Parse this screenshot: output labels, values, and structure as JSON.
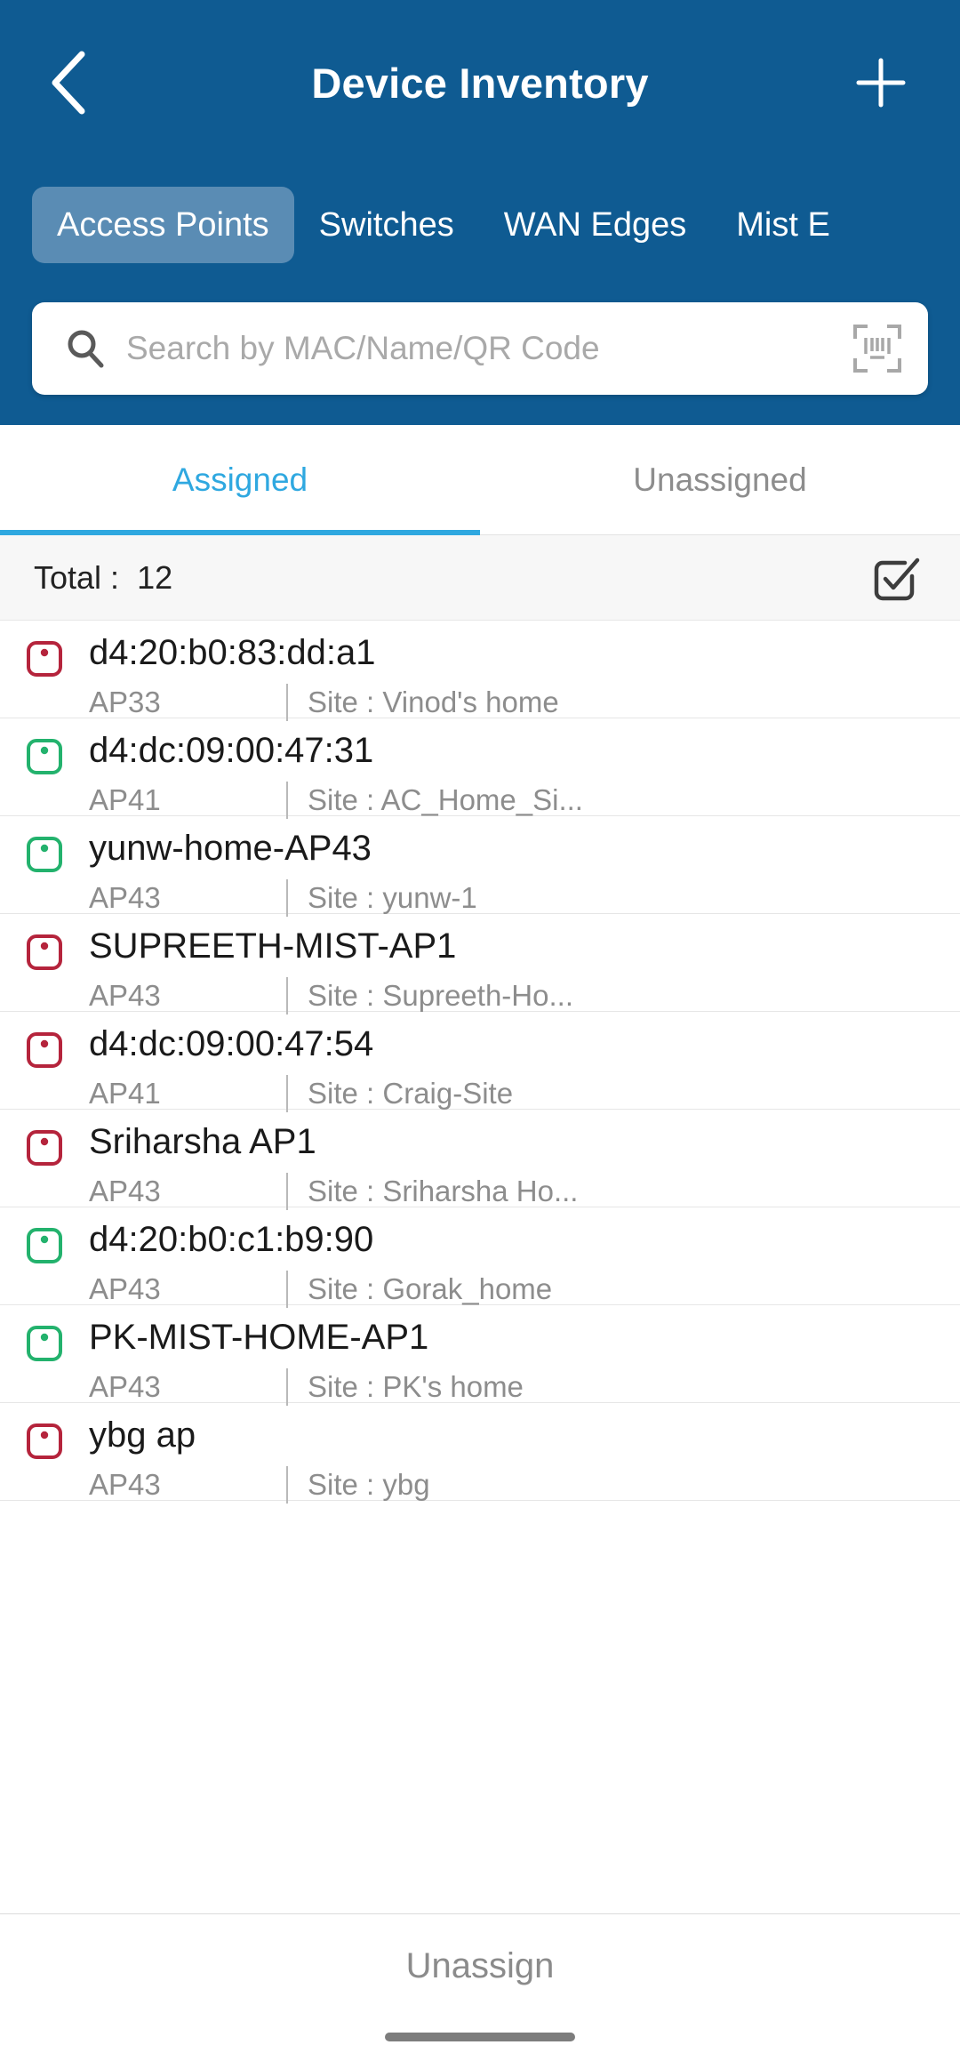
{
  "header": {
    "title": "Device Inventory",
    "back_icon": "chevron-left-icon",
    "add_icon": "plus-icon",
    "background_color": "#0f5b92",
    "category_tabs": [
      {
        "label": "Access Points",
        "active": true
      },
      {
        "label": "Switches",
        "active": false
      },
      {
        "label": "WAN Edges",
        "active": false
      },
      {
        "label": "Mist E",
        "active": false
      }
    ]
  },
  "search": {
    "placeholder": "Search by MAC/Name/QR Code",
    "value": "",
    "search_icon": "search-icon",
    "scan_icon": "barcode-scan-icon"
  },
  "sub_tabs": [
    {
      "label": "Assigned",
      "active": true
    },
    {
      "label": "Unassigned",
      "active": false
    }
  ],
  "summary": {
    "total_label": "Total :",
    "total_count": "12",
    "select_all_icon": "checkbox-checked-icon"
  },
  "accent_colors": {
    "active_tab": "#2fa8e0",
    "status_connected": "#23b26d",
    "status_disconnected": "#b5243c",
    "header_blue": "#0f5b92",
    "selected_pill": "#5a8cb4"
  },
  "devices": [
    {
      "status": "disconnected",
      "name": "d4:20:b0:83:dd:a1",
      "model": "AP33",
      "site": "Site : Vinod's home"
    },
    {
      "status": "connected",
      "name": "d4:dc:09:00:47:31",
      "model": "AP41",
      "site": "Site : AC_Home_Si..."
    },
    {
      "status": "connected",
      "name": "yunw-home-AP43",
      "model": "AP43",
      "site": "Site : yunw-1"
    },
    {
      "status": "disconnected",
      "name": "SUPREETH-MIST-AP1",
      "model": "AP43",
      "site": "Site : Supreeth-Ho..."
    },
    {
      "status": "disconnected",
      "name": "d4:dc:09:00:47:54",
      "model": "AP41",
      "site": "Site : Craig-Site"
    },
    {
      "status": "disconnected",
      "name": "Sriharsha AP1",
      "model": "AP43",
      "site": "Site : Sriharsha Ho..."
    },
    {
      "status": "connected",
      "name": "d4:20:b0:c1:b9:90",
      "model": "AP43",
      "site": "Site : Gorak_home"
    },
    {
      "status": "connected",
      "name": "PK-MIST-HOME-AP1",
      "model": "AP43",
      "site": "Site : PK's home"
    },
    {
      "status": "disconnected",
      "name": "ybg ap",
      "model": "AP43",
      "site": "Site : ybg"
    }
  ],
  "bottom_bar": {
    "unassign_label": "Unassign"
  }
}
